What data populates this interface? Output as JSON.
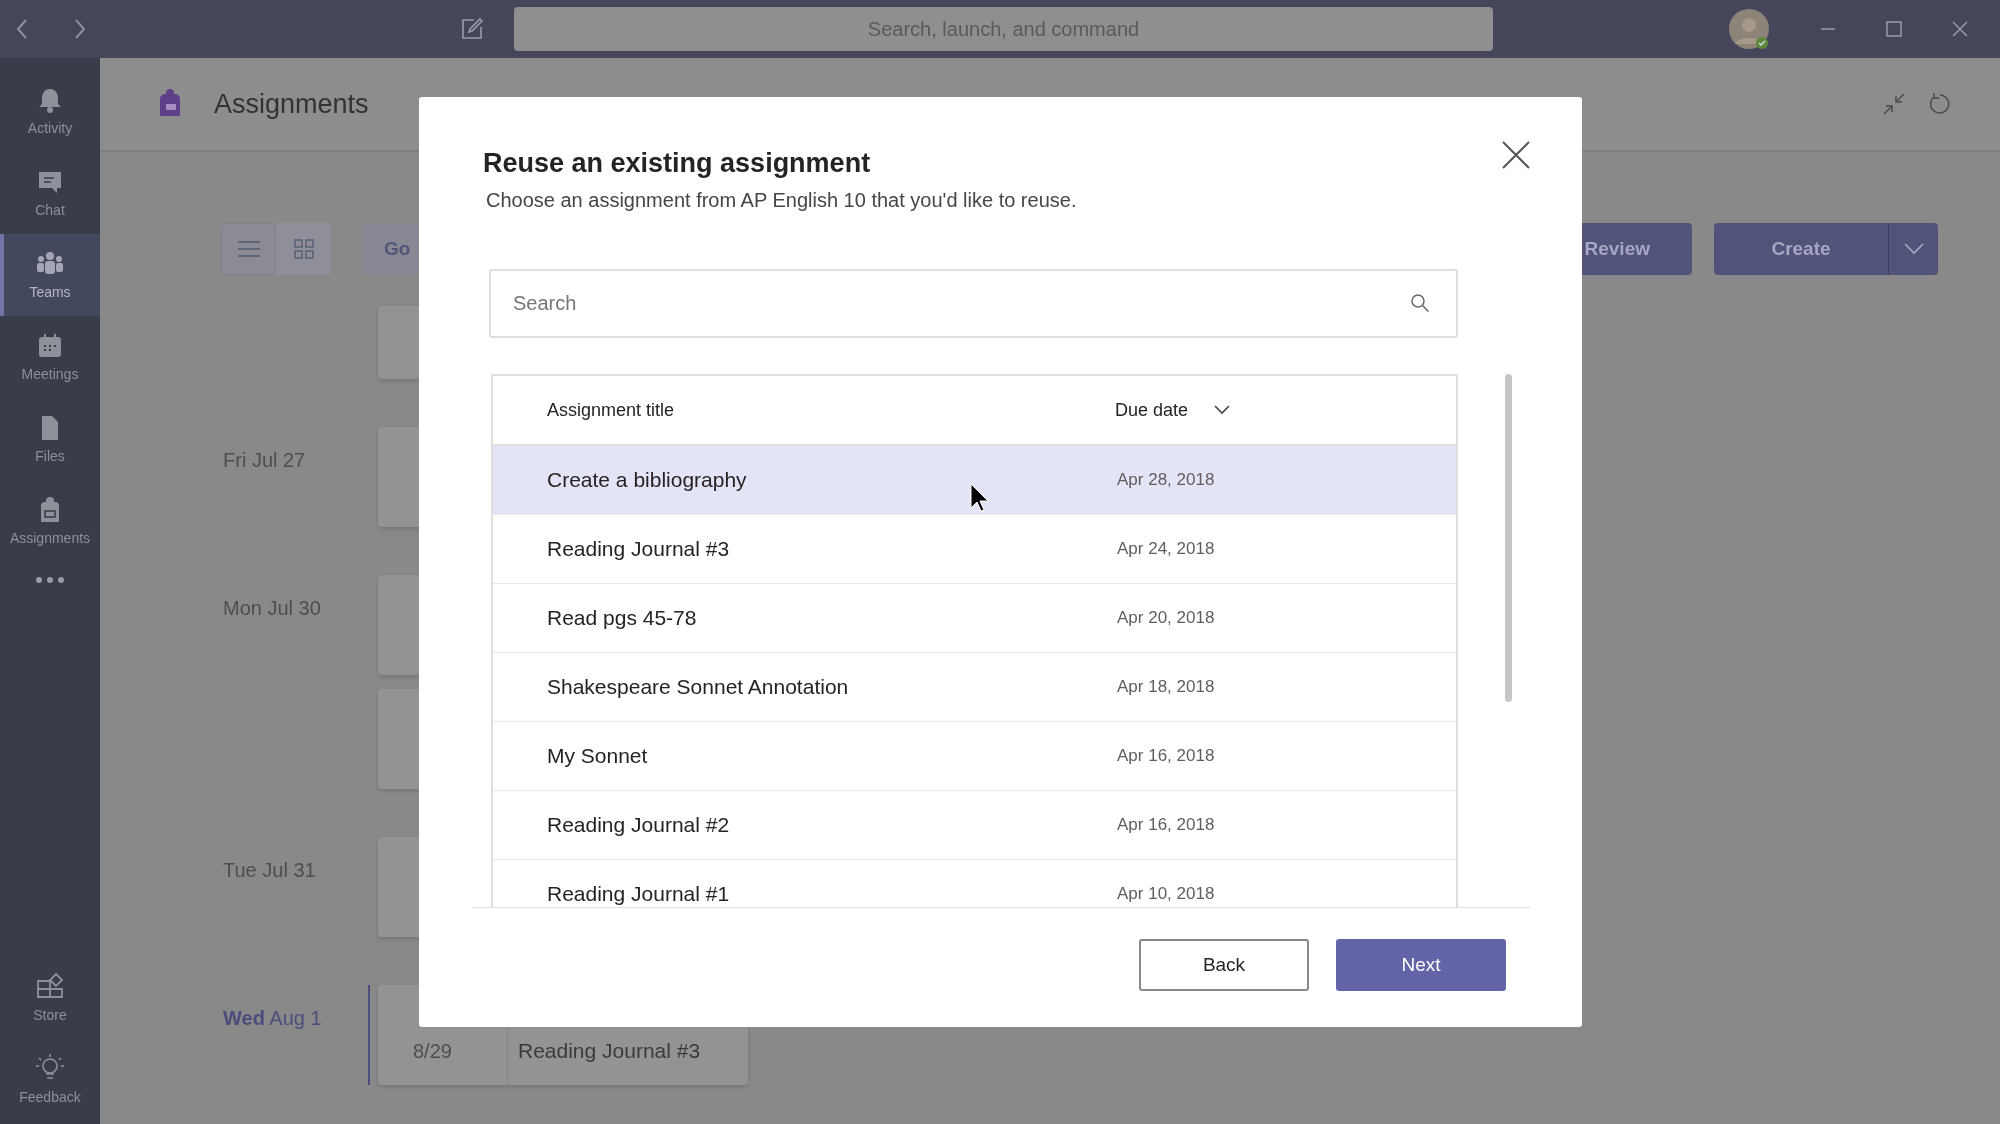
{
  "title_bar": {
    "search_placeholder": "Search, launch, and command"
  },
  "sidebar": {
    "items": [
      {
        "label": "Activity",
        "selected": false
      },
      {
        "label": "Chat",
        "selected": false
      },
      {
        "label": "Teams",
        "selected": true
      },
      {
        "label": "Meetings",
        "selected": false
      },
      {
        "label": "Files",
        "selected": false
      },
      {
        "label": "Assignments",
        "selected": false
      }
    ],
    "bottom_items": [
      {
        "label": "Store"
      },
      {
        "label": "Feedback"
      }
    ]
  },
  "page": {
    "title": "Assignments",
    "view_toggle": [
      {
        "selected": true
      },
      {
        "selected": false
      }
    ],
    "go_button": "Go",
    "review_button": "Review",
    "create_button": "Create",
    "timeline": [
      {
        "today": false,
        "cards": [
          {
            "kind": "covered"
          }
        ]
      },
      {
        "date": "Fri Jul 27",
        "today": false,
        "cards": [
          {
            "kind": "covered"
          }
        ]
      },
      {
        "date": "Mon Jul 30",
        "today": false,
        "cards": [
          {
            "kind": "covered"
          },
          {
            "kind": "covered"
          }
        ]
      },
      {
        "date": "Tue Jul 31",
        "today": false,
        "cards": [
          {
            "kind": "covered"
          }
        ]
      },
      {
        "date": "**Wed** Aug 1",
        "today": true,
        "cards": [
          {
            "kind": "detail",
            "line_2": "8/29",
            "assignment": "Reading Journal #3"
          }
        ]
      }
    ]
  },
  "dialog": {
    "title": "Reuse an existing assignment",
    "subtitle": "Choose an assignment from AP English 10 that you'd like to reuse.",
    "search_placeholder": "Search",
    "columns": [
      "Assignment title",
      "Due date"
    ],
    "rows": [
      {
        "title": "Create a bibliography",
        "due": "Apr 28, 2018",
        "selected": true
      },
      {
        "title": "Reading Journal #3",
        "due": "Apr 24, 2018",
        "selected": false
      },
      {
        "title": "Read pgs 45-78",
        "due": "Apr 20, 2018",
        "selected": false
      },
      {
        "title": "Shakespeare Sonnet Annotation",
        "due": "Apr 18, 2018",
        "selected": false
      },
      {
        "title": "My Sonnet",
        "due": "Apr 16, 2018",
        "selected": false
      },
      {
        "title": "Reading Journal #2",
        "due": "Apr 16, 2018",
        "selected": false
      },
      {
        "title": "Reading Journal #1",
        "due": "Apr 10, 2018",
        "selected": false
      }
    ],
    "buttons": [
      {
        "label": "Back",
        "kind": "secondary"
      },
      {
        "label": "Next",
        "kind": "primary"
      }
    ]
  }
}
